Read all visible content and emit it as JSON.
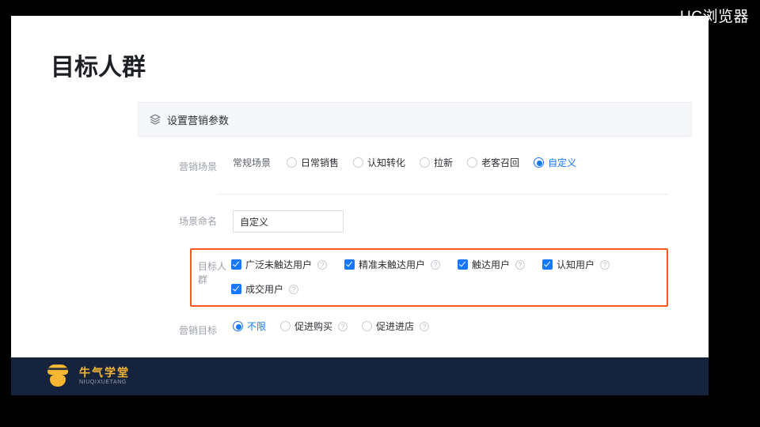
{
  "watermark": "UC浏览器",
  "page_title": "目标人群",
  "panel_header": "设置营销参数",
  "rows": {
    "scene": {
      "label": "营销场景",
      "category": "常规场景",
      "options": [
        "日常销售",
        "认知转化",
        "拉新",
        "老客召回",
        "自定义"
      ],
      "selected": "自定义"
    },
    "name": {
      "label": "场景命名",
      "value": "自定义"
    },
    "audience": {
      "label": "目标人群",
      "options": [
        "广泛未触达用户",
        "精准未触达用户",
        "触达用户",
        "认知用户",
        "成交用户"
      ]
    },
    "goal": {
      "label": "营销目标",
      "options": [
        "不限",
        "促进购买",
        "促进进店"
      ],
      "selected": "不限"
    }
  },
  "brand": {
    "cn": "牛气学堂",
    "en": "NIUQIXUETANG"
  },
  "colors": {
    "accent": "#1677ff",
    "highlight": "#ff5722",
    "brand": "#f7b733"
  }
}
